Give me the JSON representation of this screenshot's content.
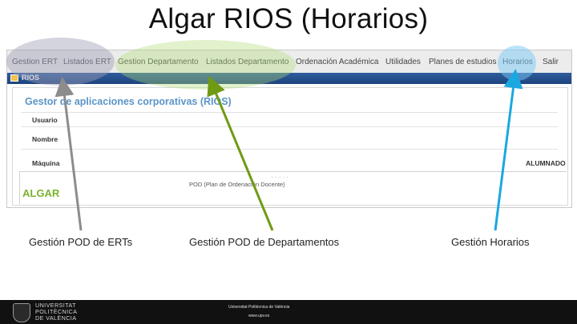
{
  "title": "Algar RIOS (Horarios)",
  "menu": [
    {
      "label": "Gestion ERT"
    },
    {
      "label": "Listados ERT"
    },
    {
      "label": "Gestion Departamento"
    },
    {
      "label": "Listados Departamento"
    },
    {
      "label": "Ordenación Académica"
    },
    {
      "label": "Utilidades"
    },
    {
      "label": "Planes de estudios"
    },
    {
      "label": "Horarios"
    },
    {
      "label": "Salir"
    }
  ],
  "window_title": "RIOS",
  "panel": {
    "heading": "Gestor de aplicaciones corporativas (RIOS)",
    "usuario_label": "Usuario",
    "nombre_label": "Nombre",
    "nombre_value": "· · · · ·",
    "maquina_label": "Máquina",
    "maquina_value": "ALUMNADO",
    "algar": "ALGAR",
    "pod": "POD (Plan de Ordenación Docente)"
  },
  "captions": {
    "ert": "Gestión POD de ERTs",
    "departamentos": "Gestión POD de Departamentos",
    "horarios": "Gestión Horarios"
  },
  "footer": {
    "university_lines": [
      "UNIVERSITAT",
      "POLITÈCNICA",
      "DE VALÈNCIA"
    ],
    "line1": "Universitat Politècnica de València",
    "line2": "www.upv.es"
  },
  "colors": {
    "ert_highlight": "#c9c9d6",
    "dept_highlight": "#d6ecbc",
    "horarios_highlight": "#bfe4f8",
    "ert_arrow": "#8c8c8c",
    "dept_arrow": "#6f9a14",
    "horarios_arrow": "#1aa8e0",
    "rios_heading": "#5b95c8",
    "algar": "#7ab32e"
  }
}
